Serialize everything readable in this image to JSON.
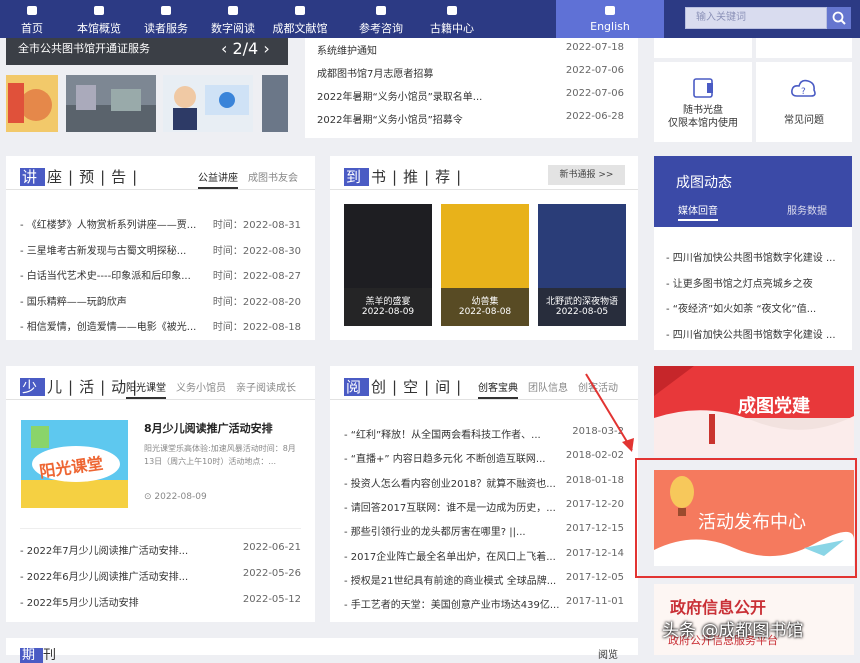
{
  "nav": {
    "items": [
      {
        "label": "首页",
        "icon": "home-icon"
      },
      {
        "label": "本馆概览",
        "icon": "book-icon"
      },
      {
        "label": "读者服务",
        "icon": "user-icon"
      },
      {
        "label": "数字阅读",
        "icon": "reading-icon"
      },
      {
        "label": "成都文献馆",
        "icon": "globe-icon"
      },
      {
        "label": "参考咨询",
        "icon": "document-icon"
      },
      {
        "label": "古籍中心",
        "icon": "ancient-book-icon"
      },
      {
        "label": "English",
        "icon": "english-icon"
      }
    ],
    "active": 7
  },
  "search": {
    "placeholder": "输入关键词",
    "icon": "search-icon"
  },
  "slider": {
    "caption": "全市公共图书馆开通证服务",
    "counter": "2/4"
  },
  "notices": [
    {
      "title": "系统维护通知",
      "date": "2022-07-18"
    },
    {
      "title": "成都图书馆7月志愿者招募",
      "date": "2022-07-06"
    },
    {
      "title": "2022年暑期“义务小馆员”录取名单...",
      "date": "2022-07-06"
    },
    {
      "title": "2022年暑期“义务小馆员”招募令",
      "date": "2022-06-28"
    }
  ],
  "services": [
    {
      "label": "随书光盘\n仅限本馆内使用",
      "icon": "cd-icon"
    },
    {
      "label": "常见问题",
      "icon": "question-cloud-icon"
    }
  ],
  "lectures": {
    "title": "讲座预告",
    "tabs": [
      "公益讲座",
      "成图书友会"
    ],
    "items": [
      {
        "title": "- 《红楼梦》人物赏析系列讲座——贾...",
        "date": "时间：2022-08-31"
      },
      {
        "title": "- 三星堆考古新发现与古蜀文明探秘...",
        "date": "时间：2022-08-30"
      },
      {
        "title": "- 白话当代艺术史----印象派和后印象...",
        "date": "时间：2022-08-27"
      },
      {
        "title": "- 国乐精粹——玩韵欣声",
        "date": "时间：2022-08-20"
      },
      {
        "title": "- 相信爱情，创造爱情——电影《被光...",
        "date": "时间：2022-08-18"
      }
    ]
  },
  "books": {
    "title": "到书推荐",
    "more": "新书通报 >>",
    "items": [
      {
        "title": "羔羊的盛宴",
        "date": "2022-08-09",
        "color": "#1e1e22"
      },
      {
        "title": "幼兽集",
        "date": "2022-08-08",
        "color": "#e8b21a"
      },
      {
        "title": "北野武的深夜物语",
        "date": "2022-08-05",
        "color": "#2a3d78"
      }
    ]
  },
  "dynamics": {
    "title": "成图动态",
    "tabs": [
      "媒体回音",
      "服务数据"
    ],
    "items": [
      "- 四川省加快公共图书馆数字化建设 ...",
      "- 让更多图书馆之灯点亮城乡之夜",
      "- “夜经济”如火如荼 “夜文化”值...",
      "- 四川省加快公共图书馆数字化建设 ..."
    ]
  },
  "children": {
    "title": "少儿活动",
    "tabs": [
      "阳光课堂",
      "义务小馆员",
      "亲子阅读成长"
    ],
    "feature": {
      "title": "8月少儿阅读推广活动安排",
      "desc": "阳光课堂乐高体验:加速风暴活动时间：8月13日（周六上午10时）活动地点：...",
      "date": "2022-08-09",
      "img_text": "阳光课堂"
    },
    "items": [
      {
        "title": "- 2022年7月少儿阅读推广活动安排...",
        "date": "2022-06-21"
      },
      {
        "title": "- 2022年6月少儿阅读推广活动安排...",
        "date": "2022-05-26"
      },
      {
        "title": "- 2022年5月少儿活动安排",
        "date": "2022-05-12"
      }
    ]
  },
  "creative": {
    "title": "阅创空间",
    "tabs": [
      "创客宝典",
      "团队信息",
      "创客活动"
    ],
    "items": [
      {
        "title": "- “红利”释放！从全国两会看科技工作者、...",
        "date": "2018-03-2"
      },
      {
        "title": "- “直播+” 内容日趋多元化 不断创造互联网...",
        "date": "2018-02-02"
      },
      {
        "title": "- 投资人怎么看内容创业2018？就算不融资也...",
        "date": "2018-01-18"
      },
      {
        "title": "- 请回答2017互联网：谁不是一边成为历史，...",
        "date": "2017-12-20"
      },
      {
        "title": "- 那些引领行业的龙头都厉害在哪里?  ||...",
        "date": "2017-12-15"
      },
      {
        "title": "- 2017企业阵亡最全名单出炉，在风口上飞着...",
        "date": "2017-12-14"
      },
      {
        "title": "- 授权是21世纪具有前途的商业模式 全球品牌...",
        "date": "2017-12-05"
      },
      {
        "title": "- 手工艺者的天堂：美国创意产业市场达439亿...",
        "date": "2017-11-01"
      }
    ]
  },
  "banners": {
    "party": "成图党建",
    "activity": "活动发布中心",
    "gov": "政府信息公开",
    "gov_sub": "政府公开信息服务平台"
  },
  "bottom": {
    "title_first": "期",
    "title_rest": "刊",
    "tab": "阅览"
  },
  "watermark": "头条 @成都图书馆",
  "colors": {
    "nav": "#2c3a84",
    "active": "#5f71d6",
    "accent": "#4a5bc4",
    "red": "#e2373a"
  }
}
